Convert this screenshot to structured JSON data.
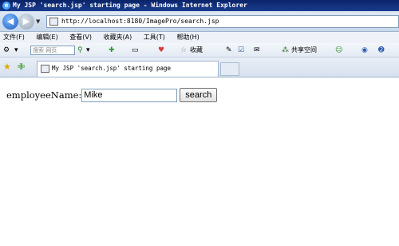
{
  "window": {
    "title": "My JSP 'search.jsp' starting page - Windows Internet Explorer"
  },
  "address_bar": {
    "url": "http://localhost:8180/ImagePro/search.jsp"
  },
  "menu": {
    "items": [
      "文件(F)",
      "编辑(E)",
      "查看(V)",
      "收藏夹(A)",
      "工具(T)",
      "帮助(H)"
    ]
  },
  "toolbar": {
    "search_placeholder": "搜索 网页",
    "favorites_label": "收藏",
    "share_label": "共享空间"
  },
  "tabs": [
    {
      "label": "My JSP 'search.jsp' starting page"
    }
  ],
  "form": {
    "label": "employeeName:",
    "input_value": "Mike",
    "button_label": "search"
  },
  "icons": {
    "back": "back-arrow-icon",
    "forward": "forward-arrow-icon",
    "favorites_star": "star-icon",
    "add_favorites": "add-favorites-icon"
  }
}
